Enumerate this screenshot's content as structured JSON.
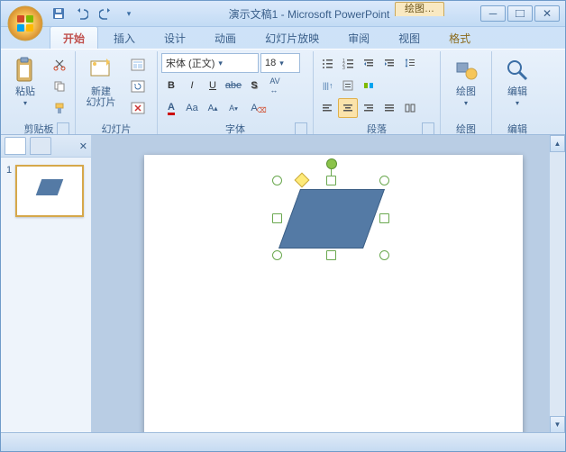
{
  "title": "演示文稿1 - Microsoft PowerPoint",
  "contextual_tab_header": "绘图…",
  "tabs": [
    "开始",
    "插入",
    "设计",
    "动画",
    "幻灯片放映",
    "审阅",
    "视图",
    "格式"
  ],
  "active_tab": 0,
  "groups": {
    "clipboard": "剪贴板",
    "slides": "幻灯片",
    "font": "字体",
    "paragraph": "段落",
    "drawing": "绘图",
    "editing": "编辑"
  },
  "buttons": {
    "paste": "粘贴",
    "new_slide": "新建\n幻灯片",
    "drawing": "绘图",
    "editing": "编辑"
  },
  "font": {
    "name": "宋体 (正文)",
    "size": "18"
  },
  "slide_panel": {
    "slide_number": "1"
  },
  "shape": {
    "type": "parallelogram",
    "fill": "#547aa5",
    "selected": true
  }
}
